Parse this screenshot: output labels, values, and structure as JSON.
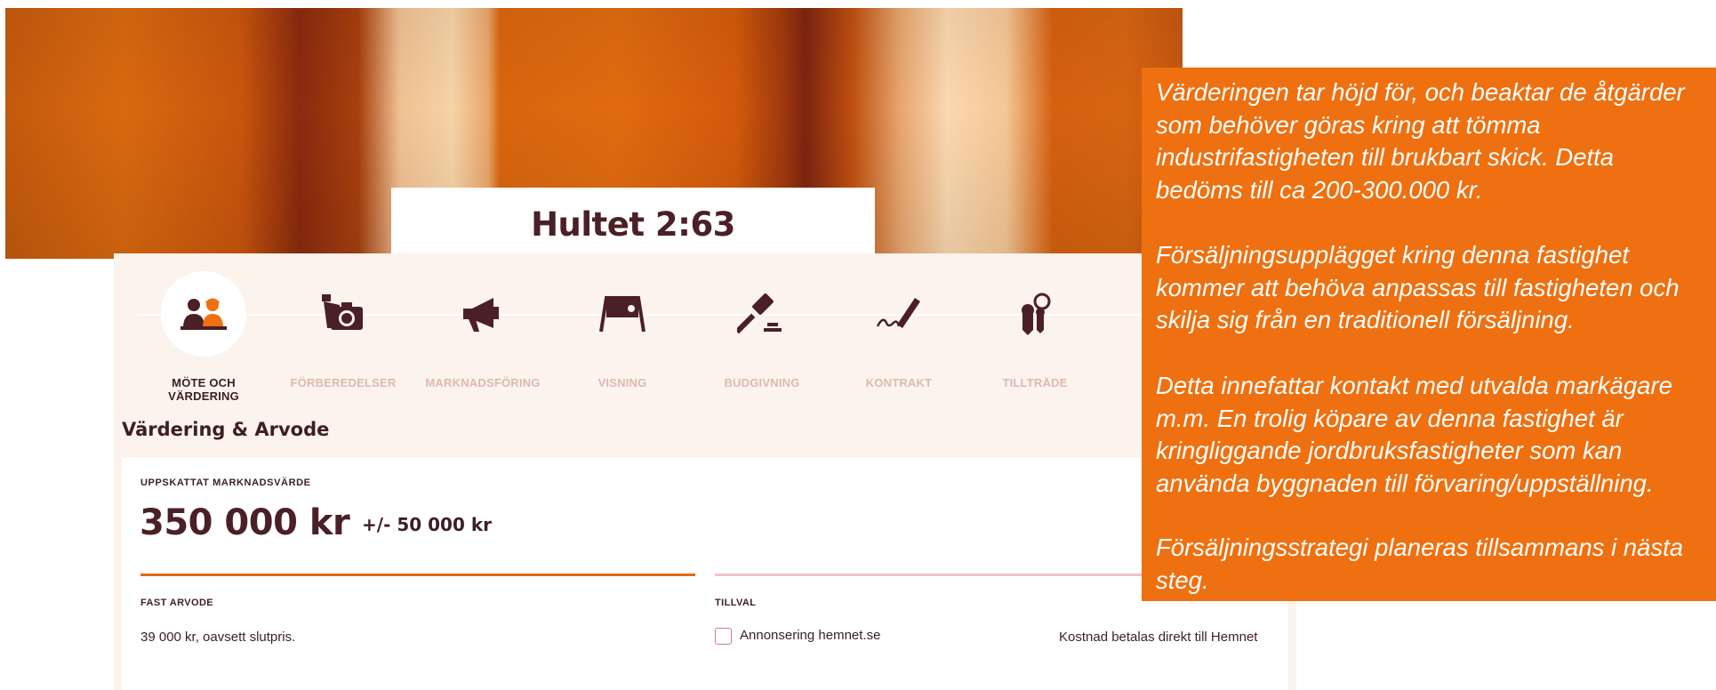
{
  "header": {
    "title": "Hultet 2:63"
  },
  "steps": [
    {
      "label": "MÖTE OCH VÄRDERING",
      "icon": "meeting-people-icon",
      "active": true
    },
    {
      "label": "FÖRBEREDELSER",
      "icon": "camera-icon",
      "active": false
    },
    {
      "label": "MARKNADSFÖRING",
      "icon": "megaphone-icon",
      "active": false
    },
    {
      "label": "VISNING",
      "icon": "sign-board-icon",
      "active": false
    },
    {
      "label": "BUDGIVNING",
      "icon": "gavel-icon",
      "active": false
    },
    {
      "label": "KONTRAKT",
      "icon": "signature-pen-icon",
      "active": false
    },
    {
      "label": "TILLTRÄDE",
      "icon": "keys-icon",
      "active": false
    }
  ],
  "valuation": {
    "section_title": "Värdering & Arvode",
    "estimate_label": "UPPSKATTAT MARKNADSVÄRDE",
    "price": "350 000 kr",
    "range": "+/- 50 000 kr",
    "fee_label": "FAST ARVODE",
    "fee_text": "39 000 kr, oavsett slutpris.",
    "addon_label": "TILLVAL",
    "addon_option": "Annonsering hemnet.se",
    "addon_checked": false,
    "addon_note": "Kostnad betalas direkt till Hemnet"
  },
  "note": {
    "paragraph1": "Värderingen tar höjd för, och beaktar de åtgärder som behöver göras kring att tömma industrifastigheten till brukbart skick. Detta bedöms till ca 200-300.000 kr.",
    "paragraph2": "Försäljningsupplägget kring denna fastighet kommer att behöva anpassas till fastigheten och skilja sig från en traditionell försäljning.",
    "paragraph3": "Detta innefattar kontakt med utvalda markägare m.m. En trolig köpare av denna fastighet är kringliggande jordbruksfastigheter som kan använda byggnaden till förvaring/uppställning.",
    "paragraph4": "Försäljningsstrategi planeras tillsammans i nästa steg."
  },
  "colors": {
    "accent_orange": "#ee7010",
    "progress_orange": "#e4681a",
    "dark_text": "#3d1e24",
    "panel_bg": "#fcf3ec",
    "inactive_label": "#dcb9ad"
  }
}
